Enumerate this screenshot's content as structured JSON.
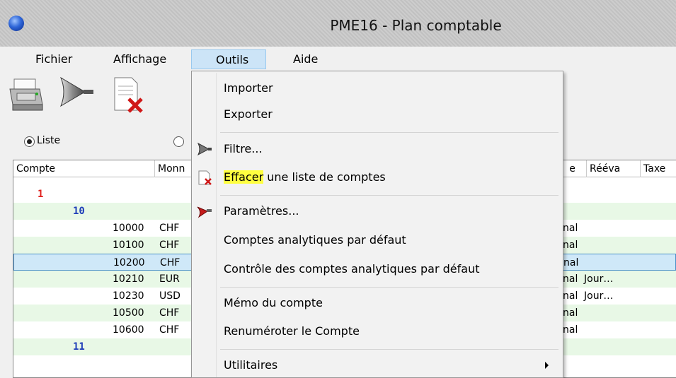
{
  "window": {
    "title": "PME16 - Plan comptable"
  },
  "menubar": {
    "items": [
      {
        "label": "Fichier"
      },
      {
        "label": "Affichage"
      },
      {
        "label": "Outils"
      },
      {
        "label": "Aide"
      }
    ]
  },
  "toolbar": {
    "icons": [
      "printer-icon",
      "filter-funnel-icon",
      "delete-list-icon"
    ]
  },
  "view": {
    "options": [
      {
        "label": "Liste",
        "checked": true
      },
      {
        "label": "",
        "checked": false
      }
    ]
  },
  "grid": {
    "columns": [
      "Compte",
      "Monn",
      "e",
      "Rééva",
      "Taxe"
    ],
    "rows": [
      {
        "compte": "1",
        "monnaie": "",
        "type": "",
        "reeval": "",
        "level": 1
      },
      {
        "compte": "10",
        "monnaie": "",
        "type": "",
        "reeval": "",
        "level": 2
      },
      {
        "compte": "10000",
        "monnaie": "CHF",
        "type": "nal",
        "reeval": "",
        "level": 3
      },
      {
        "compte": "10100",
        "monnaie": "CHF",
        "type": "nal",
        "reeval": "",
        "level": 3
      },
      {
        "compte": "10200",
        "monnaie": "CHF",
        "type": "nal",
        "reeval": "",
        "level": 3,
        "selected": true
      },
      {
        "compte": "10210",
        "monnaie": "EUR",
        "type": "nal",
        "reeval": "Jour…",
        "level": 3
      },
      {
        "compte": "10230",
        "monnaie": "USD",
        "type": "nal",
        "reeval": "Jour…",
        "level": 3
      },
      {
        "compte": "10500",
        "monnaie": "CHF",
        "type": "nal",
        "reeval": "",
        "level": 3
      },
      {
        "compte": "10600",
        "monnaie": "CHF",
        "type": "nal",
        "reeval": "",
        "level": 3
      },
      {
        "compte": "11",
        "monnaie": "",
        "type": "",
        "reeval": "",
        "level": 2
      }
    ]
  },
  "dropdown": {
    "importer": "Importer",
    "exporter": "Exporter",
    "filtre": "Filtre...",
    "effacer_highlight": "Effacer",
    "effacer_rest": " une liste de comptes",
    "parametres": "Paramètres...",
    "analytiques_defaut": "Comptes analytiques par défaut",
    "controle_analytiques": "Contrôle des comptes analytiques par défaut",
    "memo": "Mémo du compte",
    "renumeroter": "Renuméroter le Compte",
    "utilitaires": "Utilitaires"
  },
  "colors": {
    "highlight": "#ffff40",
    "level1": "#e0201c",
    "level2": "#1e3db8",
    "alt_row": "#e8f8e6",
    "selected_row": "#cfe8f8"
  }
}
